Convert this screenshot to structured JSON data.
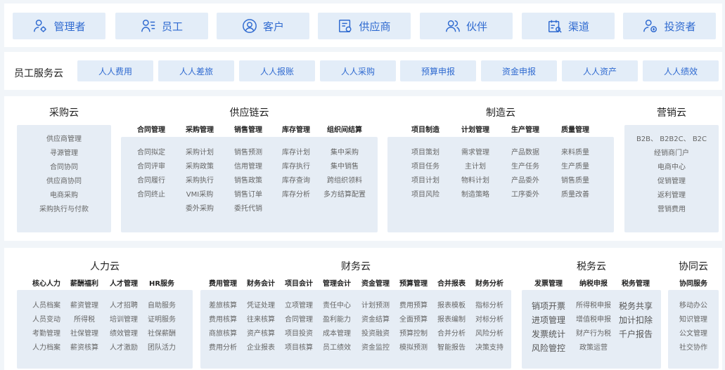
{
  "roles": [
    {
      "label": "管理者",
      "icon": "admin-icon"
    },
    {
      "label": "员工",
      "icon": "employee-list-icon"
    },
    {
      "label": "客户",
      "icon": "customer-face-icon"
    },
    {
      "label": "供应商",
      "icon": "supplier-doc-icon"
    },
    {
      "label": "伙伴",
      "icon": "partner-people-icon"
    },
    {
      "label": "渠道",
      "icon": "channel-calendar-icon"
    },
    {
      "label": "投资者",
      "icon": "investor-icon"
    }
  ],
  "employee_cloud": {
    "title": "员工服务云",
    "items": [
      "人人费用",
      "人人差旅",
      "人人报账",
      "人人采购",
      "预算申报",
      "资金申报",
      "人人资产",
      "人人绩效"
    ]
  },
  "procurement": {
    "title": "采购云",
    "items": [
      "供应商管理",
      "寻源管理",
      "合同协同",
      "供应商协同",
      "电商采购",
      "采购执行与付款"
    ]
  },
  "supply_chain": {
    "title": "供应链云",
    "columns": [
      {
        "header": "合同管理",
        "items": [
          "合同拟定",
          "合同评审",
          "合同履行",
          "合同终止"
        ]
      },
      {
        "header": "采购管理",
        "items": [
          "采购计划",
          "采购政策",
          "采购执行",
          "VMI采购",
          "委外采购"
        ]
      },
      {
        "header": "销售管理",
        "items": [
          "销售预测",
          "信用管理",
          "销售政策",
          "销售订单",
          "委托代销"
        ]
      },
      {
        "header": "库存管理",
        "items": [
          "库存计划",
          "库存执行",
          "库存查询",
          "库存分析"
        ]
      },
      {
        "header": "组织间结算",
        "items": [
          "集中采购",
          "集中销售",
          "跨组织领料",
          "多方结算配置"
        ]
      }
    ]
  },
  "manufacturing": {
    "title": "制造云",
    "columns": [
      {
        "header": "项目制造",
        "items": [
          "项目策划",
          "项目任务",
          "项目计划",
          "项目风险"
        ]
      },
      {
        "header": "计划管理",
        "items": [
          "需求管理",
          "主计划",
          "物料计划",
          "制造策略"
        ]
      },
      {
        "header": "生产管理",
        "items": [
          "产品数据",
          "生产任务",
          "产品委外",
          "工序委外"
        ]
      },
      {
        "header": "质量管理",
        "items": [
          "来料质量",
          "生产质量",
          "销售质量",
          "质量改善"
        ]
      }
    ]
  },
  "marketing": {
    "title": "营销云",
    "items": [
      "B2B、 B2B2C、 B2C",
      "经销商门户",
      "电商中心",
      "促销管理",
      "返利管理",
      "营销费用"
    ]
  },
  "hr": {
    "title": "人力云",
    "columns": [
      {
        "header": "核心人力",
        "items": [
          "人员档案",
          "人员变动",
          "考勤管理",
          "人力档案"
        ]
      },
      {
        "header": "薪酬福利",
        "items": [
          "薪资管理",
          "所得税",
          "社保管理",
          "薪资核算"
        ]
      },
      {
        "header": "人才管理",
        "items": [
          "人才招聘",
          "培训管理",
          "绩效管理",
          "人才激励"
        ]
      },
      {
        "header": "HR服务",
        "items": [
          "自助服务",
          "证明服务",
          "社保薪酬",
          "团队活力"
        ]
      }
    ]
  },
  "finance": {
    "title": "财务云",
    "columns": [
      {
        "header": "费用管理",
        "items": [
          "差旅核算",
          "费用核算",
          "商旅核算",
          "费用分析"
        ]
      },
      {
        "header": "财务会计",
        "items": [
          "凭证处理",
          "往来核算",
          "资产核算",
          "企业报表"
        ]
      },
      {
        "header": "项目会计",
        "items": [
          "立项管理",
          "合同管理",
          "项目投资",
          "项目核算"
        ]
      },
      {
        "header": "管理会计",
        "items": [
          "责任中心",
          "盈利能力",
          "成本管理",
          "员工绩效"
        ]
      },
      {
        "header": "资金管理",
        "items": [
          "计划预测",
          "资金结算",
          "投资融资",
          "资金监控"
        ]
      },
      {
        "header": "预算管理",
        "items": [
          "费用预算",
          "全面预算",
          "预算控制",
          "模拟预测"
        ]
      },
      {
        "header": "合并报表",
        "items": [
          "报表模板",
          "报表编制",
          "合并分析",
          "智能报告"
        ]
      },
      {
        "header": "财务分析",
        "items": [
          "指标分析",
          "对标分析",
          "风险分析",
          "决策支持"
        ]
      }
    ]
  },
  "tax": {
    "title": "税务云",
    "columns": [
      {
        "header": "发票管理",
        "items": [
          "销项开票",
          "进项管理",
          "发票统计",
          "风险管控"
        ]
      },
      {
        "header": "纳税申报",
        "items": [
          "所得税申报",
          "增值税申报",
          "财产行为税",
          "政策运营"
        ]
      },
      {
        "header": "税务管理",
        "items": [
          "税务共享",
          "加计扣除",
          "千户报告"
        ]
      }
    ]
  },
  "collab": {
    "title": "协同云",
    "header": "协同服务",
    "items": [
      "移动办公",
      "知识管理",
      "公文管理",
      "社交协作"
    ]
  }
}
